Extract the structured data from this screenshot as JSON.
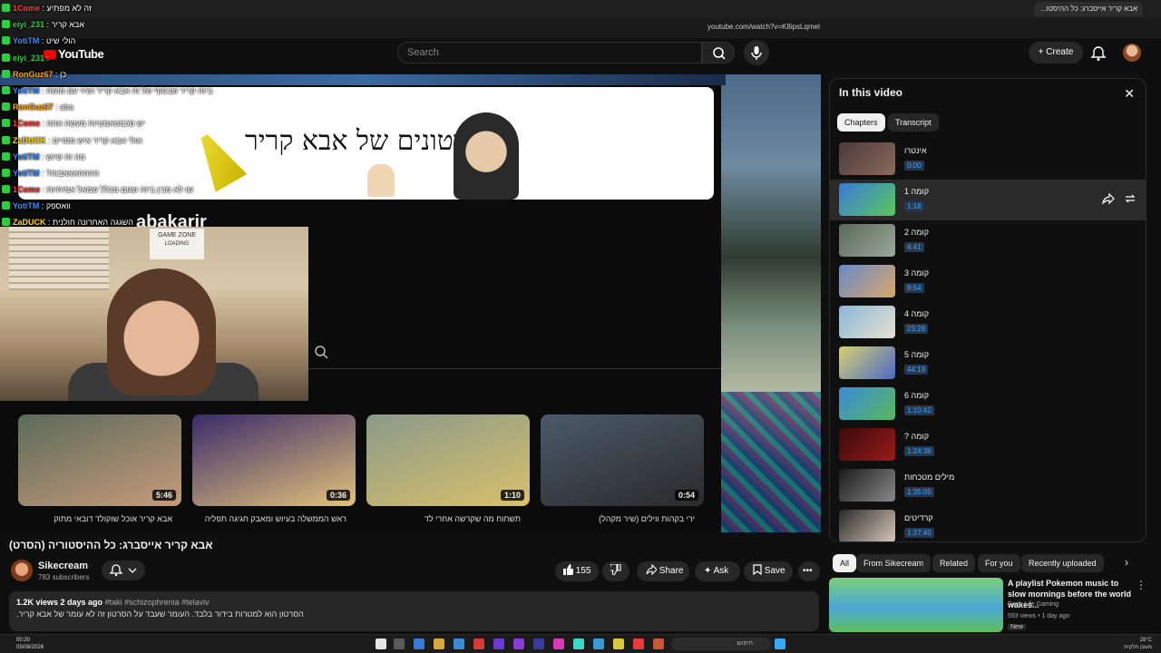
{
  "browser": {
    "tab_title": "אבא קריר אייסברג: כל ההיסטו...",
    "url": "youtube.com/watch?v=K8ipsLqmel"
  },
  "header": {
    "logo_text": "YouTube",
    "search_placeholder": "Search",
    "create_label": "Create"
  },
  "chat": [
    {
      "user": "1Come",
      "msg": "זה לא מפתיע",
      "color": "#ff3b3b"
    },
    {
      "user": "eiyi_231",
      "msg": "אבא קריר",
      "color": "#2ecc40"
    },
    {
      "user": "YotiTM",
      "msg": "הולי שיט",
      "color": "#3b8cff"
    },
    {
      "user": "eiyi_231",
      "msg": "",
      "color": "#2ecc40"
    },
    {
      "user": "RonGuz67",
      "msg": "כן",
      "color": "#ffa500"
    },
    {
      "user": "YotiTM",
      "msg": "ביזה קריר שבסוף של זה אבא קריר ושיוי עם מושה",
      "color": "#3b8cff"
    },
    {
      "user": "RonGuz67",
      "msg": "aba",
      "color": "#ffa500"
    },
    {
      "user": "1Come",
      "msg": "יש סכמטאמטיות מעשה אהה",
      "color": "#ff3b3b"
    },
    {
      "user": "ZaDUCK",
      "msg": "אולי אבא קריר איש מסויים",
      "color": "#ffd700"
    },
    {
      "user": "YotiTM",
      "msg": "מה זה שיוש",
      "color": "#3b8cff"
    },
    {
      "user": "YotiTM",
      "msg": "ההההאאאבוה?",
      "color": "#3b8cff"
    },
    {
      "user": "1Come",
      "msg": "שו לא מכין ביזה שגום מכלל שמאל אמיתיות",
      "color": "#ff3b3b"
    },
    {
      "user": "YotiTM",
      "msg": "וואספק",
      "color": "#3b8cff"
    },
    {
      "user": "ZaDUCK",
      "msg": "השגגה האחרונה חולנית",
      "color": "#ffd700"
    }
  ],
  "player": {
    "banner_title": "הסרטונים של אבא קריר",
    "channel_peek": "abakarir",
    "webcam_sign": "GAME ZONE",
    "webcam_sign_sub": "LOADING"
  },
  "recs": [
    {
      "title": "אבא קריר אוכל שוקולד דובאי מתוק",
      "duration": "5:46",
      "c1": "#5b6b5a",
      "c2": "#c79a7a"
    },
    {
      "title": "ראש הממשלה בעיוש ומאבק חגיגה תפליה",
      "duration": "0:36",
      "c1": "#3a2a6a",
      "c2": "#e2c27a"
    },
    {
      "title": "תשחוח מה שקרשה אחרי לד",
      "duration": "1:10",
      "c1": "#8a9a8a",
      "c2": "#d9c06a"
    },
    {
      "title": "ירי בקהות ווילים (שיר מקהל)",
      "duration": "0:54",
      "c1": "#4a5a6a",
      "c2": "#2a2a2a"
    }
  ],
  "video": {
    "title": "אבא קריר אייסברג: כל ההיסטוריה (הסרט)",
    "channel": "Sikecream",
    "subscribers": "783 subscribers",
    "likes": "155",
    "share_label": "Share",
    "ask_label": "Ask",
    "save_label": "Save",
    "views_date": "1.2K views  2 days ago",
    "tags": "#taki #schizophrenia #telaviv",
    "description": "הסרטון הוא למטרות בידור בלבד. העומר שעבד על הסרטון זה לא עומר של אבא קריר."
  },
  "panel": {
    "title": "In this video",
    "tab_chapters": "Chapters",
    "tab_transcript": "Transcript",
    "chapters": [
      {
        "title": "אינטרו",
        "time": "0:00",
        "c1": "#4a3a3a",
        "c2": "#8a6a5a"
      },
      {
        "title": "קומה 1",
        "time": "1:18",
        "c1": "#3a7ad8",
        "c2": "#5ac85a"
      },
      {
        "title": "קומה 2",
        "time": "4:41",
        "c1": "#5a6a5a",
        "c2": "#9aa89a"
      },
      {
        "title": "קומה 3",
        "time": "9:54",
        "c1": "#6a8ac8",
        "c2": "#d8a86a"
      },
      {
        "title": "קומה 4",
        "time": "23:28",
        "c1": "#8ab8d8",
        "c2": "#e8e0d0"
      },
      {
        "title": "קומה 5",
        "time": "44:19",
        "c1": "#d8d070",
        "c2": "#4a6ac8"
      },
      {
        "title": "קומה 6",
        "time": "1:10:42",
        "c1": "#3a8ad8",
        "c2": "#5ab85a"
      },
      {
        "title": "קומה ?",
        "time": "1:24:38",
        "c1": "#3a0a0a",
        "c2": "#9a1a1a"
      },
      {
        "title": "מילים מטכחות",
        "time": "1:35:05",
        "c1": "#1a1a1a",
        "c2": "#8a8a8a"
      },
      {
        "title": "קרדיטים",
        "time": "1:37:40",
        "c1": "#2a2a2a",
        "c2": "#d8c8b8"
      }
    ]
  },
  "chips": [
    "All",
    "From Sikecream",
    "Related",
    "For you",
    "Recently uploaded"
  ],
  "side_rec": {
    "title": "A playlist Pokemon music to slow mornings before the world wakes...",
    "channel": "Farm Life Gaming",
    "meta": "593 views • 1 day ago",
    "badge": "New"
  },
  "taskbar": {
    "time": "00:20",
    "date": "05/08/2026",
    "search": "חיפוש",
    "right_top": "28°C",
    "right_bottom": "מעונן חלקית"
  }
}
